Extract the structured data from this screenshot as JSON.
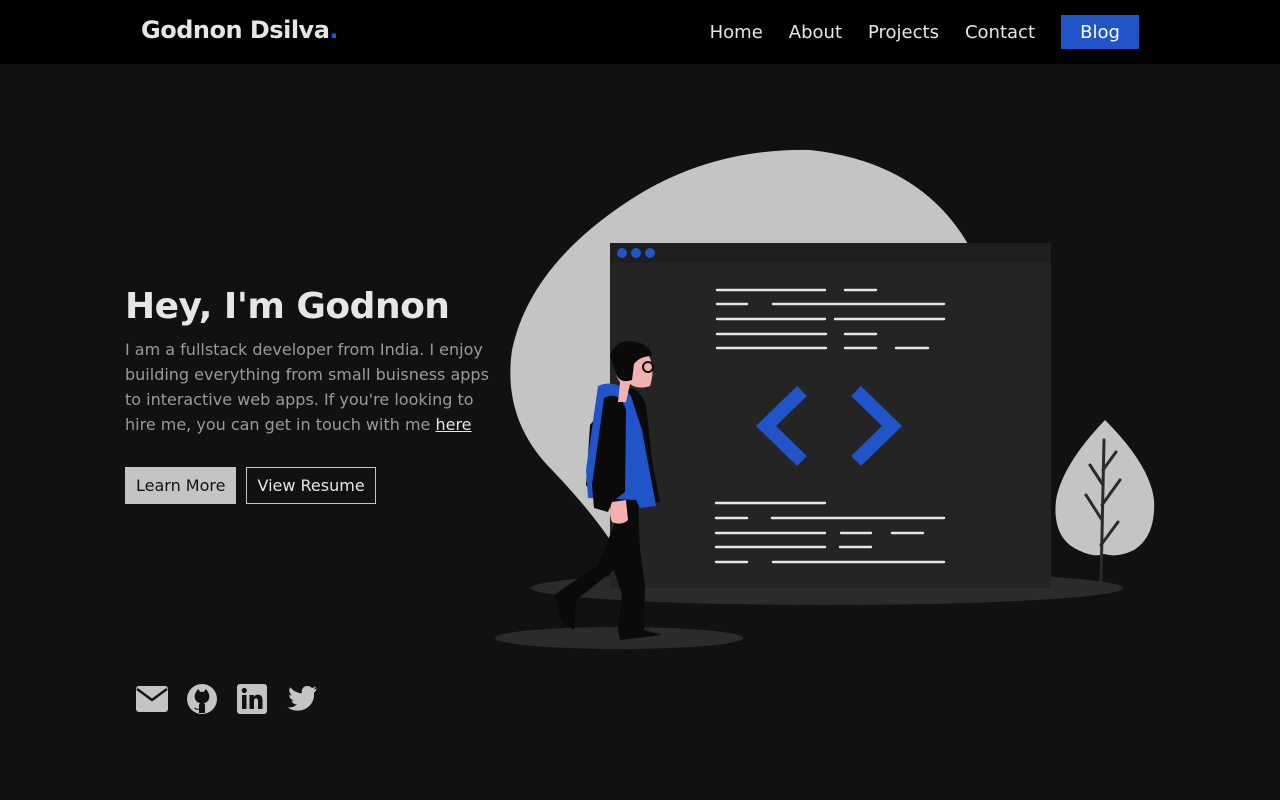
{
  "brand": {
    "name": "Godnon Dsilva",
    "dot": "."
  },
  "nav": {
    "links": [
      "Home",
      "About",
      "Projects",
      "Contact"
    ],
    "blog": "Blog"
  },
  "hero": {
    "title": "Hey, I'm Godnon",
    "description": "I am a fullstack developer from India. I enjoy building everything from small buisness apps to interactive web apps. If you're looking to hire me, you can get in touch with me ",
    "link_text": "here"
  },
  "buttons": {
    "learn_more": "Learn More",
    "view_resume": "View Resume"
  },
  "social": [
    "envelope-icon",
    "github-icon",
    "linkedin-icon",
    "twitter-icon"
  ],
  "colors": {
    "background": "#111111",
    "navbar": "#000000",
    "accent": "#2153c9",
    "light": "#c4c4c4",
    "text": "#e6e6e6",
    "muted": "#9a9a9a"
  }
}
